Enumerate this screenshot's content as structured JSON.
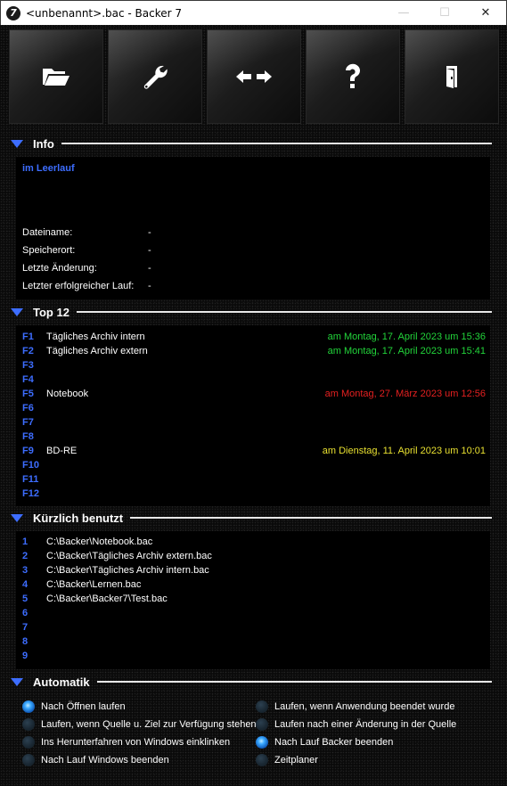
{
  "window": {
    "title": "<unbenannt>.bac - Backer 7",
    "icon_label": "7",
    "controls": {
      "minimize": "—",
      "maximize": "☐",
      "close": "✕"
    }
  },
  "toolbar": {
    "buttons": [
      {
        "icon": "folder-open-icon"
      },
      {
        "icon": "wrench-icon"
      },
      {
        "icon": "arrows-left-right-icon"
      },
      {
        "icon": "question-icon"
      },
      {
        "icon": "exit-door-icon"
      }
    ]
  },
  "info": {
    "title": "Info",
    "status": "im Leerlauf",
    "rows": [
      {
        "label": "Dateiname:",
        "value": "-"
      },
      {
        "label": "Speicherort:",
        "value": "-"
      },
      {
        "label": "Letzte Änderung:",
        "value": "-"
      },
      {
        "label": "Letzter erfolgreicher Lauf:",
        "value": "-"
      }
    ]
  },
  "top12": {
    "title": "Top 12",
    "items": [
      {
        "key": "F1",
        "name": "Tägliches Archiv intern",
        "date": "am Montag, 17. April 2023 um 15:36",
        "color": "#22d43a"
      },
      {
        "key": "F2",
        "name": "Tägliches Archiv extern",
        "date": "am Montag, 17. April 2023 um 15:41",
        "color": "#22d43a"
      },
      {
        "key": "F3",
        "name": "",
        "date": ""
      },
      {
        "key": "F4",
        "name": "",
        "date": ""
      },
      {
        "key": "F5",
        "name": "Notebook",
        "date": "am Montag, 27. März 2023 um 12:56",
        "color": "#e42020"
      },
      {
        "key": "F6",
        "name": "",
        "date": ""
      },
      {
        "key": "F7",
        "name": "",
        "date": ""
      },
      {
        "key": "F8",
        "name": "",
        "date": ""
      },
      {
        "key": "F9",
        "name": "BD-RE",
        "date": "am Dienstag, 11. April 2023 um 10:01",
        "color": "#e8e030"
      },
      {
        "key": "F10",
        "name": "",
        "date": ""
      },
      {
        "key": "F11",
        "name": "",
        "date": ""
      },
      {
        "key": "F12",
        "name": "",
        "date": ""
      }
    ]
  },
  "recent": {
    "title": "Kürzlich benutzt",
    "items": [
      {
        "key": "1",
        "path": "C:\\Backer\\Notebook.bac"
      },
      {
        "key": "2",
        "path": "C:\\Backer\\Tägliches Archiv extern.bac"
      },
      {
        "key": "3",
        "path": "C:\\Backer\\Tägliches Archiv intern.bac"
      },
      {
        "key": "4",
        "path": "C:\\Backer\\Lernen.bac"
      },
      {
        "key": "5",
        "path": "C:\\Backer\\Backer7\\Test.bac"
      },
      {
        "key": "6",
        "path": ""
      },
      {
        "key": "7",
        "path": ""
      },
      {
        "key": "8",
        "path": ""
      },
      {
        "key": "9",
        "path": ""
      }
    ]
  },
  "automatik": {
    "title": "Automatik",
    "options": [
      {
        "label": "Nach Öffnen laufen",
        "checked": true
      },
      {
        "label": "Laufen, wenn Anwendung beendet wurde",
        "checked": false
      },
      {
        "label": "Laufen, wenn Quelle u. Ziel zur Verfügung stehen",
        "checked": false
      },
      {
        "label": "Laufen nach einer Änderung in der Quelle",
        "checked": false
      },
      {
        "label": "Ins Herunterfahren von Windows einklinken",
        "checked": false
      },
      {
        "label": "Nach Lauf Backer beenden",
        "checked": true
      },
      {
        "label": "Nach Lauf Windows beenden",
        "checked": false
      },
      {
        "label": "Zeitplaner",
        "checked": false
      }
    ]
  }
}
